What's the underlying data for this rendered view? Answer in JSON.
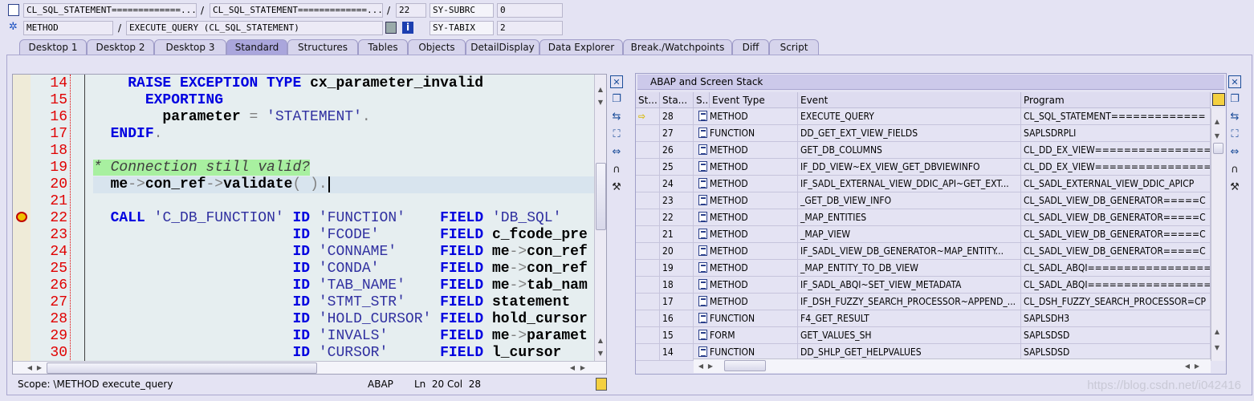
{
  "header": {
    "row1": {
      "program": "CL_SQL_STATEMENT=============...",
      "include": "CL_SQL_STATEMENT=============...",
      "line": "22",
      "sysvar": "SY-SUBRC",
      "sysval": "0"
    },
    "row2": {
      "event_type": "METHOD",
      "event": "EXECUTE_QUERY (CL_SQL_STATEMENT)",
      "sysvar": "SY-TABIX",
      "sysval": "2"
    },
    "separator": "/"
  },
  "tabs": [
    {
      "label": "Desktop 1"
    },
    {
      "label": "Desktop 2"
    },
    {
      "label": "Desktop 3"
    },
    {
      "label": "Standard",
      "active": true
    },
    {
      "label": "Structures"
    },
    {
      "label": "Tables"
    },
    {
      "label": "Objects"
    },
    {
      "label": "DetailDisplay"
    },
    {
      "label": "Data Explorer"
    },
    {
      "label": "Break./Watchpoints"
    },
    {
      "label": "Diff"
    },
    {
      "label": "Script"
    }
  ],
  "editor": {
    "breakpoint_line": 22,
    "current_line": 20,
    "lines": [
      {
        "n": "14",
        "t": [
          [
            "",
            "    "
          ],
          [
            "kw",
            "RAISE EXCEPTION TYPE"
          ],
          [
            "id",
            " cx_parameter_invalid"
          ]
        ]
      },
      {
        "n": "15",
        "t": [
          [
            "",
            "      "
          ],
          [
            "kw",
            "EXPORTING"
          ]
        ]
      },
      {
        "n": "16",
        "t": [
          [
            "",
            "        "
          ],
          [
            "id",
            "parameter"
          ],
          [
            "op",
            " = "
          ],
          [
            "str",
            "'STATEMENT'"
          ],
          [
            "op",
            "."
          ]
        ]
      },
      {
        "n": "17",
        "t": [
          [
            "",
            "  "
          ],
          [
            "kw",
            "ENDIF"
          ],
          [
            "op",
            "."
          ]
        ]
      },
      {
        "n": "18",
        "t": []
      },
      {
        "n": "19",
        "t": [
          [
            "cm",
            "* Connection still valid?"
          ]
        ]
      },
      {
        "n": "20",
        "t": [
          [
            "",
            "  "
          ],
          [
            "id",
            "me"
          ],
          [
            "op",
            "->"
          ],
          [
            "id",
            "con_ref"
          ],
          [
            "op",
            "->"
          ],
          [
            "id",
            "validate"
          ],
          [
            "op",
            "( )."
          ]
        ]
      },
      {
        "n": "21",
        "t": []
      },
      {
        "n": "22",
        "t": [
          [
            "",
            "  "
          ],
          [
            "kw",
            "CALL"
          ],
          [
            "",
            " "
          ],
          [
            "str",
            "'C_DB_FUNCTION'"
          ],
          [
            "",
            " "
          ],
          [
            "kw",
            "ID"
          ],
          [
            "",
            " "
          ],
          [
            "str",
            "'FUNCTION'"
          ],
          [
            "",
            "    "
          ],
          [
            "kw",
            "FIELD"
          ],
          [
            "",
            " "
          ],
          [
            "str",
            "'DB_SQL'"
          ]
        ]
      },
      {
        "n": "23",
        "t": [
          [
            "",
            "                       "
          ],
          [
            "kw",
            "ID"
          ],
          [
            "",
            " "
          ],
          [
            "str",
            "'FCODE'"
          ],
          [
            "",
            "       "
          ],
          [
            "kw",
            "FIELD"
          ],
          [
            "id",
            " c_fcode_pre"
          ]
        ]
      },
      {
        "n": "24",
        "t": [
          [
            "",
            "                       "
          ],
          [
            "kw",
            "ID"
          ],
          [
            "",
            " "
          ],
          [
            "str",
            "'CONNAME'"
          ],
          [
            "",
            "     "
          ],
          [
            "kw",
            "FIELD"
          ],
          [
            "id",
            " me"
          ],
          [
            "op",
            "->"
          ],
          [
            "id",
            "con_ref"
          ]
        ]
      },
      {
        "n": "25",
        "t": [
          [
            "",
            "                       "
          ],
          [
            "kw",
            "ID"
          ],
          [
            "",
            " "
          ],
          [
            "str",
            "'CONDA'"
          ],
          [
            "",
            "       "
          ],
          [
            "kw",
            "FIELD"
          ],
          [
            "id",
            " me"
          ],
          [
            "op",
            "->"
          ],
          [
            "id",
            "con_ref"
          ]
        ]
      },
      {
        "n": "26",
        "t": [
          [
            "",
            "                       "
          ],
          [
            "kw",
            "ID"
          ],
          [
            "",
            " "
          ],
          [
            "str",
            "'TAB_NAME'"
          ],
          [
            "",
            "    "
          ],
          [
            "kw",
            "FIELD"
          ],
          [
            "id",
            " me"
          ],
          [
            "op",
            "->"
          ],
          [
            "id",
            "tab_nam"
          ]
        ]
      },
      {
        "n": "27",
        "t": [
          [
            "",
            "                       "
          ],
          [
            "kw",
            "ID"
          ],
          [
            "",
            " "
          ],
          [
            "str",
            "'STMT_STR'"
          ],
          [
            "",
            "    "
          ],
          [
            "kw",
            "FIELD"
          ],
          [
            "id",
            " statement"
          ]
        ]
      },
      {
        "n": "28",
        "t": [
          [
            "",
            "                       "
          ],
          [
            "kw",
            "ID"
          ],
          [
            "",
            " "
          ],
          [
            "str",
            "'HOLD_CURSOR'"
          ],
          [
            "",
            " "
          ],
          [
            "kw",
            "FIELD"
          ],
          [
            "id",
            " hold_cursor"
          ]
        ]
      },
      {
        "n": "29",
        "t": [
          [
            "",
            "                       "
          ],
          [
            "kw",
            "ID"
          ],
          [
            "",
            " "
          ],
          [
            "str",
            "'INVALS'"
          ],
          [
            "",
            "      "
          ],
          [
            "kw",
            "FIELD"
          ],
          [
            "id",
            " me"
          ],
          [
            "op",
            "->"
          ],
          [
            "id",
            "paramet"
          ]
        ]
      },
      {
        "n": "30",
        "t": [
          [
            "",
            "                       "
          ],
          [
            "kw",
            "ID"
          ],
          [
            "",
            " "
          ],
          [
            "str",
            "'CURSOR'"
          ],
          [
            "",
            "      "
          ],
          [
            "kw",
            "FIELD"
          ],
          [
            "id",
            " l_cursor"
          ]
        ]
      }
    ]
  },
  "status": {
    "scope": "Scope: \\METHOD execute_query",
    "lang": "ABAP",
    "position": "Ln  20 Col  28"
  },
  "stack": {
    "title": "ABAP and Screen Stack",
    "columns": [
      "St...",
      "Sta...",
      "S..",
      "Event Type",
      "Event",
      "Program"
    ],
    "rows": [
      {
        "level": "28",
        "type": "METHOD",
        "event": "EXECUTE_QUERY",
        "program": "CL_SQL_STATEMENT=============",
        "current": true
      },
      {
        "level": "27",
        "type": "FUNCTION",
        "event": "DD_GET_EXT_VIEW_FIELDS",
        "program": "SAPLSDRPLI"
      },
      {
        "level": "26",
        "type": "METHOD",
        "event": "GET_DB_COLUMNS",
        "program": "CL_DD_EX_VIEW================"
      },
      {
        "level": "25",
        "type": "METHOD",
        "event": "IF_DD_VIEW~EX_VIEW_GET_DBVIEWINFO",
        "program": "CL_DD_EX_VIEW================"
      },
      {
        "level": "24",
        "type": "METHOD",
        "event": "IF_SADL_EXTERNAL_VIEW_DDIC_API~GET_EXT...",
        "program": "CL_SADL_EXTERNAL_VIEW_DDIC_APICP"
      },
      {
        "level": "23",
        "type": "METHOD",
        "event": "_GET_DB_VIEW_INFO",
        "program": "CL_SADL_VIEW_DB_GENERATOR=====C"
      },
      {
        "level": "22",
        "type": "METHOD",
        "event": "_MAP_ENTITIES",
        "program": "CL_SADL_VIEW_DB_GENERATOR=====C"
      },
      {
        "level": "21",
        "type": "METHOD",
        "event": "_MAP_VIEW",
        "program": "CL_SADL_VIEW_DB_GENERATOR=====C"
      },
      {
        "level": "20",
        "type": "METHOD",
        "event": "IF_SADL_VIEW_DB_GENERATOR~MAP_ENTITY...",
        "program": "CL_SADL_VIEW_DB_GENERATOR=====C"
      },
      {
        "level": "19",
        "type": "METHOD",
        "event": "_MAP_ENTITY_TO_DB_VIEW",
        "program": "CL_SADL_ABQI================="
      },
      {
        "level": "18",
        "type": "METHOD",
        "event": "IF_SADL_ABQI~SET_VIEW_METADATA",
        "program": "CL_SADL_ABQI================="
      },
      {
        "level": "17",
        "type": "METHOD",
        "event": "IF_DSH_FUZZY_SEARCH_PROCESSOR~APPEND_...",
        "program": "CL_DSH_FUZZY_SEARCH_PROCESSOR=CP"
      },
      {
        "level": "16",
        "type": "FUNCTION",
        "event": "F4_GET_RESULT",
        "program": "SAPLSDH3"
      },
      {
        "level": "15",
        "type": "FORM",
        "event": "GET_VALUES_SH",
        "program": "SAPLSDSD"
      },
      {
        "level": "14",
        "type": "FUNCTION",
        "event": "DD_SHLP_GET_HELPVALUES",
        "program": "SAPLSDSD"
      }
    ]
  },
  "watermark": "https://blog.csdn.net/i042416",
  "colors": {
    "keyword": "#0000e0",
    "line_number": "#e00000",
    "comment_bg": "#a8f0a0",
    "active_tab": "#aaa6dc"
  }
}
